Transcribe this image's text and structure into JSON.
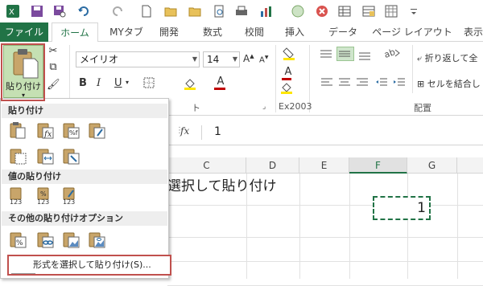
{
  "tabs": [
    "ファイル",
    "ホーム",
    "MYタブ",
    "開発",
    "数式",
    "校閲",
    "挿入",
    "データ",
    "ページ レイアウト",
    "表示"
  ],
  "active_tab": "ホーム",
  "ribbon": {
    "paste_label": "貼り付け",
    "font_name": "メイリオ",
    "font_size": "14",
    "wrap_text": "折り返して全",
    "merge_center": "セルを結合し",
    "group_font_suffix": "ト",
    "group_ex2003": "Ex2003",
    "group_alignment": "配置"
  },
  "formula_bar": {
    "fx": "fx",
    "value": "1"
  },
  "columns": [
    "C",
    "D",
    "E",
    "F",
    "G"
  ],
  "cells": {
    "title_text": "選択して貼り付け",
    "f_value": "1"
  },
  "paste_menu": {
    "section1": "貼り付け",
    "section2": "値の貼り付け",
    "section3": "その他の貼り付けオプション",
    "special_item": "形式を選択して貼り付け(S)..."
  },
  "colors": {
    "excel_green": "#217346",
    "highlight_red": "#c0504d",
    "paste_active": "#c5e0b3"
  }
}
